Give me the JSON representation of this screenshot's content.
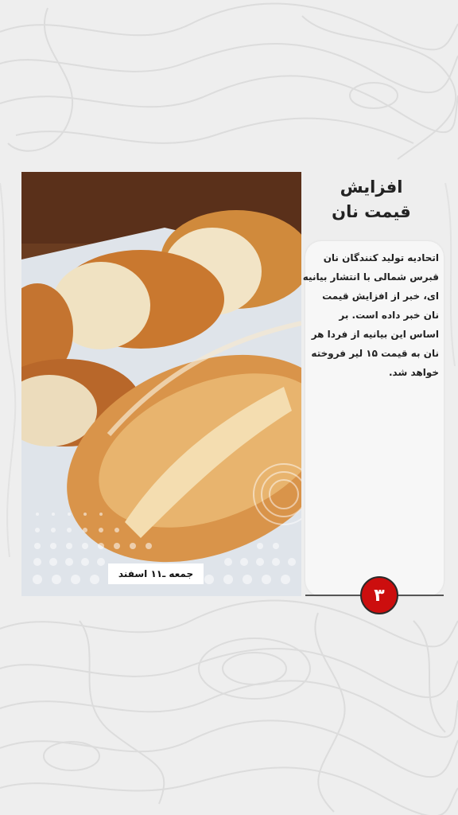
{
  "news": {
    "title_line1": "افزایش",
    "title_line2": "قیمت نان",
    "body_lines": [
      "اتحادیه تولید کنندگان نان",
      "قبرس شمالی با انتشار بیانیه",
      "ای، خبر از افزایش قیمت",
      "نان خبر داده است. بر",
      "اساس این بیانیه از فردا هر",
      "نان به قیمت ۱۵ لیر فروخته",
      "خواهد شد."
    ]
  },
  "date_badge": "جمعه  ـ۱۱ اسفند",
  "page_number": "۳",
  "colors": {
    "background": "#eeeeee",
    "page_circle": "#cc0e0e",
    "card": "#f7f7f7"
  },
  "image": {
    "subject": "bread-loaves-photo"
  }
}
